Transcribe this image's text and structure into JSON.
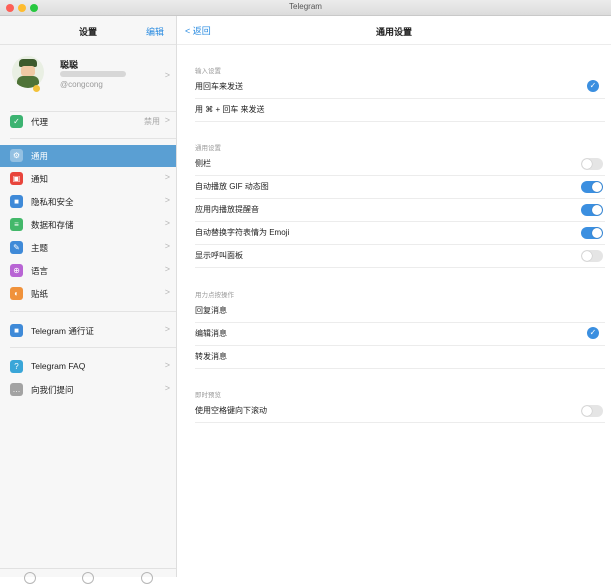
{
  "window": {
    "title": "Telegram"
  },
  "sidebar": {
    "title": "设置",
    "edit_label": "编辑",
    "profile": {
      "name": "聪聪",
      "username": "@congcong"
    },
    "items": [
      {
        "label": "代理",
        "value": "禁用",
        "icon": "shield-icon",
        "color": "#3cb371"
      },
      {
        "label": "通用",
        "icon": "gear-icon",
        "color": "#5a9fd3",
        "active": true
      },
      {
        "label": "通知",
        "icon": "bell-icon",
        "color": "#e8453c"
      },
      {
        "label": "隐私和安全",
        "icon": "lock-icon",
        "color": "#3f8ad8"
      },
      {
        "label": "数据和存储",
        "icon": "database-icon",
        "color": "#43b86a"
      },
      {
        "label": "主题",
        "icon": "brush-icon",
        "color": "#3f8ad8"
      },
      {
        "label": "语言",
        "icon": "globe-icon",
        "color": "#b865d4"
      },
      {
        "label": "贴纸",
        "icon": "sticker-icon",
        "color": "#f0923b"
      },
      {
        "label": "Telegram 通行证",
        "icon": "passport-icon",
        "color": "#3f8ad8"
      },
      {
        "label": "Telegram FAQ",
        "icon": "help-icon",
        "color": "#3aa6d8"
      },
      {
        "label": "向我们提问",
        "icon": "chat-icon",
        "color": "#a3a3a3"
      }
    ]
  },
  "main": {
    "back_label": "返回",
    "title": "通用设置",
    "sections": [
      {
        "label": "输入设置",
        "rows": [
          {
            "label": "用回车来发送",
            "control": "check",
            "checked": true
          },
          {
            "label": "用 ⌘ + 回车 来发送",
            "control": "check",
            "checked": false
          }
        ]
      },
      {
        "label": "通用设置",
        "rows": [
          {
            "label": "侧栏",
            "control": "toggle",
            "on": false
          },
          {
            "label": "自动播放 GIF 动态图",
            "control": "toggle",
            "on": true
          },
          {
            "label": "应用内播放提醒音",
            "control": "toggle",
            "on": true
          },
          {
            "label": "自动替换字符表情为 Emoji",
            "control": "toggle",
            "on": true
          },
          {
            "label": "显示呼叫面板",
            "control": "toggle",
            "on": false
          }
        ]
      },
      {
        "label": "用力点按操作",
        "rows": [
          {
            "label": "回复消息",
            "control": "check",
            "checked": false
          },
          {
            "label": "编辑消息",
            "control": "check",
            "checked": true
          },
          {
            "label": "转发消息",
            "control": "check",
            "checked": false
          }
        ]
      },
      {
        "label": "即时预览",
        "rows": [
          {
            "label": "使用空格键向下滚动",
            "control": "toggle",
            "on": false
          }
        ]
      }
    ]
  }
}
